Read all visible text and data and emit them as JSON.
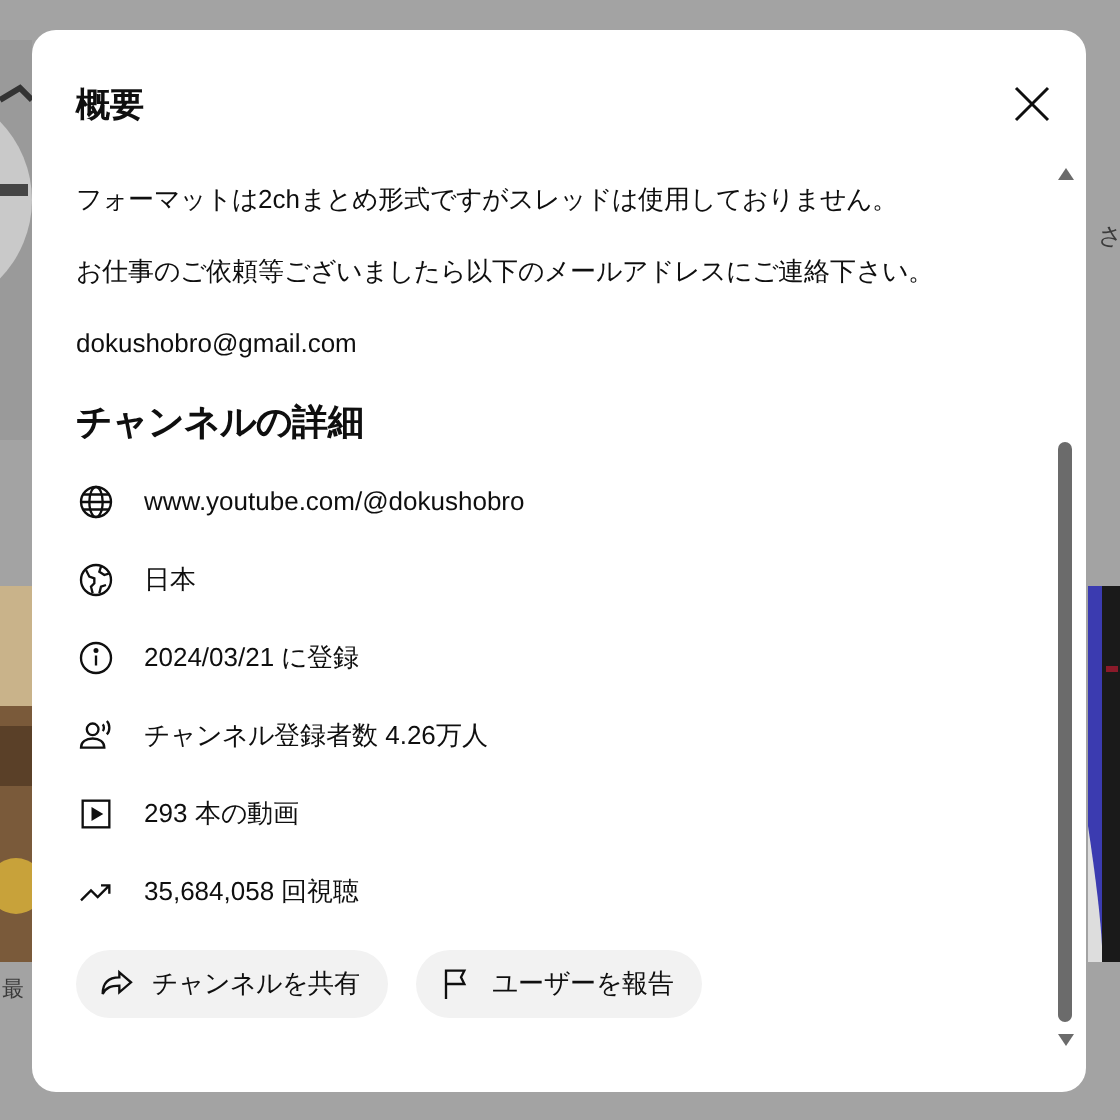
{
  "background": {
    "left_caption": "最",
    "right_caption": "さ"
  },
  "dialog": {
    "title": "概要",
    "description": [
      "フォーマットは2chまとめ形式ですがスレッドは使用しておりません。",
      "お仕事のご依頼等ございましたら以下のメールアドレスにご連絡下さい。"
    ],
    "email": "dokushobro@gmail.com",
    "details_heading": "チャンネルの詳細",
    "details": [
      {
        "kind": "link",
        "text": "www.youtube.com/@dokushobro"
      },
      {
        "kind": "country",
        "text": "日本"
      },
      {
        "kind": "joined",
        "text": "2024/03/21 に登録"
      },
      {
        "kind": "subscribers",
        "text": "チャンネル登録者数 4.26万人"
      },
      {
        "kind": "videos",
        "text": "293 本の動画"
      },
      {
        "kind": "views",
        "text": "35,684,058 回視聴"
      }
    ],
    "buttons": [
      {
        "kind": "share",
        "label": "チャンネルを共有"
      },
      {
        "kind": "report",
        "label": "ユーザーを報告"
      }
    ]
  }
}
